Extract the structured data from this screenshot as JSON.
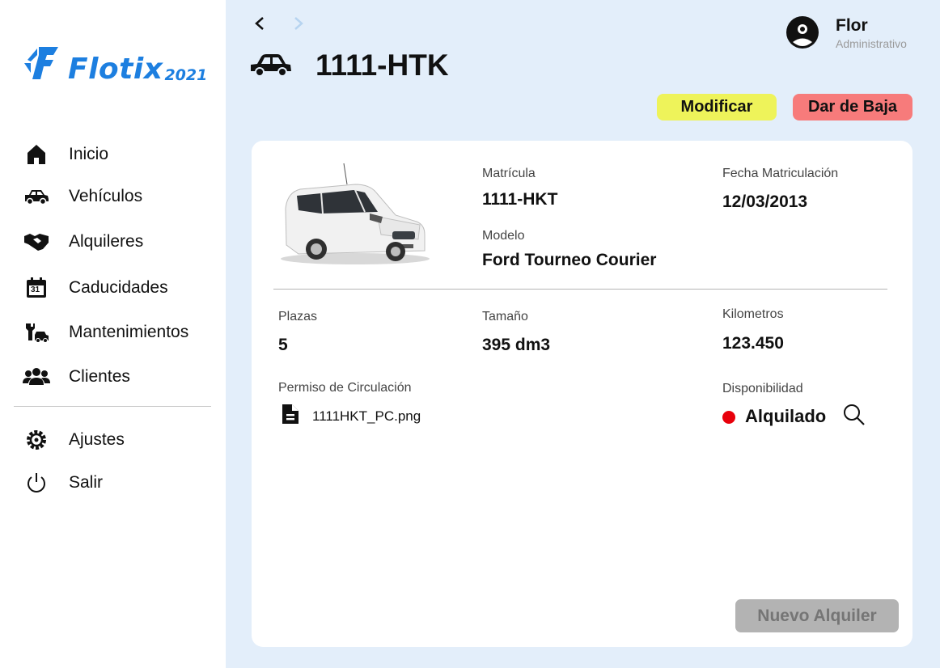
{
  "app": {
    "logo_text": "Flotix",
    "logo_year": "2021"
  },
  "sidebar": {
    "items": [
      {
        "label": "Inicio",
        "icon": "home-icon"
      },
      {
        "label": "Vehículos",
        "icon": "car-icon"
      },
      {
        "label": "Alquileres",
        "icon": "handshake-icon"
      },
      {
        "label": "Caducidades",
        "icon": "calendar-icon"
      },
      {
        "label": "Mantenimientos",
        "icon": "wrench-car-icon"
      },
      {
        "label": "Clientes",
        "icon": "users-icon"
      }
    ],
    "bottom_items": [
      {
        "label": "Ajustes",
        "icon": "gear-icon"
      },
      {
        "label": "Salir",
        "icon": "power-icon"
      }
    ],
    "calendar_day": "31"
  },
  "header": {
    "title": "1111-HTK",
    "back_icon": "chevron-left-icon",
    "forward_icon": "chevron-right-icon"
  },
  "user": {
    "name": "Flor",
    "role": "Administrativo"
  },
  "actions": {
    "modify_label": "Modificar",
    "drop_label": "Dar de Baja"
  },
  "vehicle": {
    "plate_label": "Matrícula",
    "plate_value": "1111-HKT",
    "model_label": "Modelo",
    "model_value": "Ford Tourneo Courier",
    "registration_date_label": "Fecha Matriculación",
    "registration_date_value": "12/03/2013",
    "seats_label": "Plazas",
    "seats_value": "5",
    "size_label": "Tamaño",
    "size_value": "395 dm3",
    "km_label": "Kilometros",
    "km_value": "123.450",
    "permit_label": "Permiso de Circulación",
    "permit_file": "1111HKT_PC.png",
    "availability_label": "Disponibilidad",
    "availability_value": "Alquilado",
    "availability_color": "#e8000b"
  },
  "footer": {
    "new_rental_label": "Nuevo Alquiler"
  },
  "colors": {
    "brand": "#1d7fe0",
    "background": "#e3eefa",
    "modify_button": "#eef35a",
    "drop_button": "#f77b7b",
    "disabled_button": "#b3b3b3"
  }
}
